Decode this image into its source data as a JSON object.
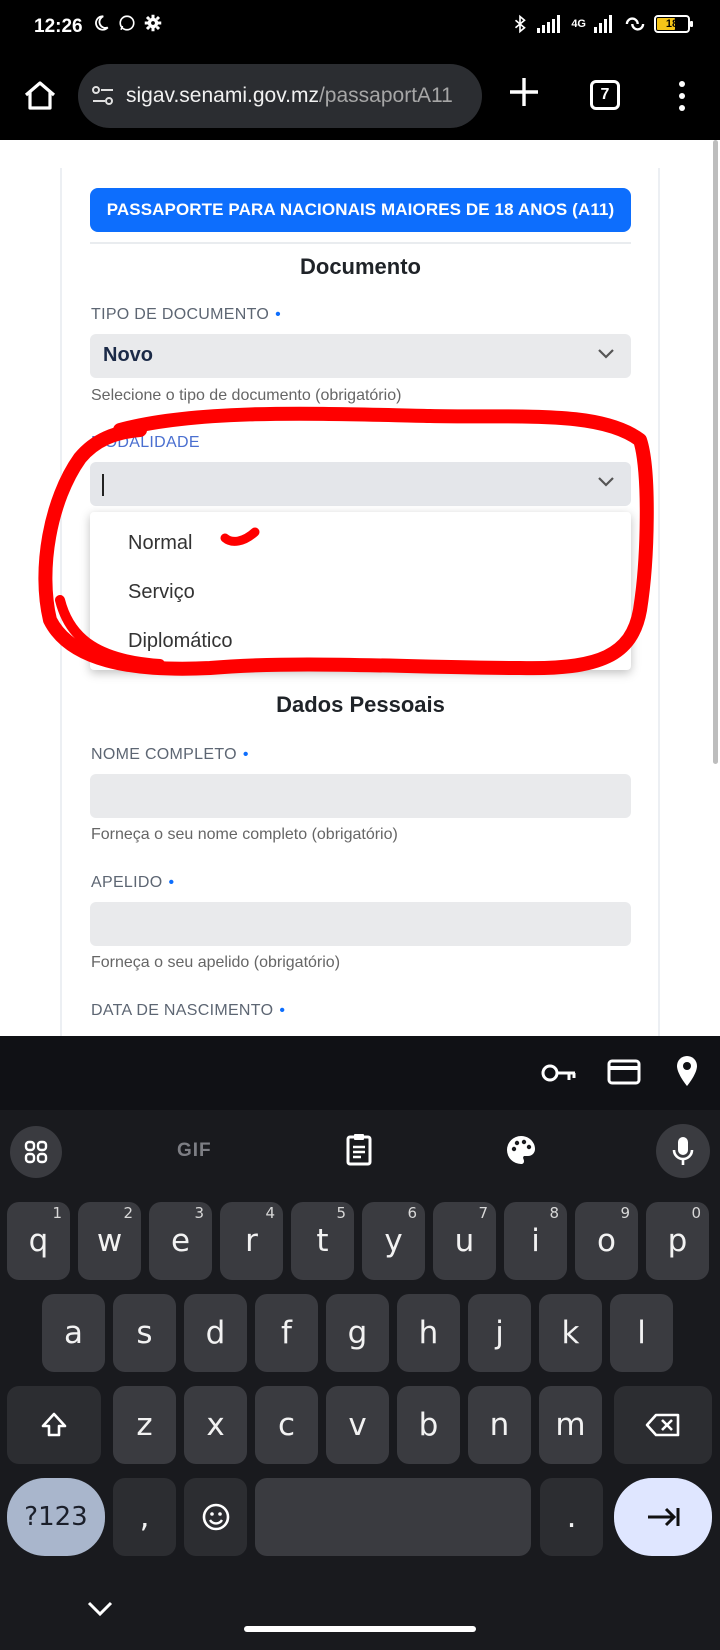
{
  "status_bar": {
    "time": "12:26",
    "battery": "18",
    "network": "4G"
  },
  "browser": {
    "url_host": "sigav.senami.gov.mz",
    "url_path": "/passaportA11",
    "tab_count": "7"
  },
  "form": {
    "banner": "PASSAPORTE PARA NACIONAIS MAIORES DE 18 ANOS (A11)",
    "section_documento": "Documento",
    "tipo_documento": {
      "label": "TIPO DE DOCUMENTO",
      "value": "Novo",
      "help": "Selecione o tipo de documento (obrigatório)"
    },
    "modalidade": {
      "label": "MODALIDADE",
      "value": "",
      "options": [
        "Normal",
        "Serviço",
        "Diplomático"
      ]
    },
    "section_dados": "Dados Pessoais",
    "nome_completo": {
      "label": "NOME COMPLETO",
      "help": "Forneça o seu nome completo (obrigatório)"
    },
    "apelido": {
      "label": "APELIDO",
      "help": "Forneça o seu apelido (obrigatório)"
    },
    "data_nascimento": {
      "label": "DATA DE NASCIMENTO"
    },
    "required_marker": "•"
  },
  "keyboard": {
    "gif_label": "GIF",
    "row1": [
      {
        "k": "q",
        "n": "1"
      },
      {
        "k": "w",
        "n": "2"
      },
      {
        "k": "e",
        "n": "3"
      },
      {
        "k": "r",
        "n": "4"
      },
      {
        "k": "t",
        "n": "5"
      },
      {
        "k": "y",
        "n": "6"
      },
      {
        "k": "u",
        "n": "7"
      },
      {
        "k": "i",
        "n": "8"
      },
      {
        "k": "o",
        "n": "9"
      },
      {
        "k": "p",
        "n": "0"
      }
    ],
    "row2": [
      "a",
      "s",
      "d",
      "f",
      "g",
      "h",
      "j",
      "k",
      "l"
    ],
    "row3": [
      "z",
      "x",
      "c",
      "v",
      "b",
      "n",
      "m"
    ],
    "sym_label": "?123",
    "comma": ",",
    "period": "."
  },
  "colors": {
    "accent": "#0d6efd",
    "annotation": "#ff0000"
  }
}
